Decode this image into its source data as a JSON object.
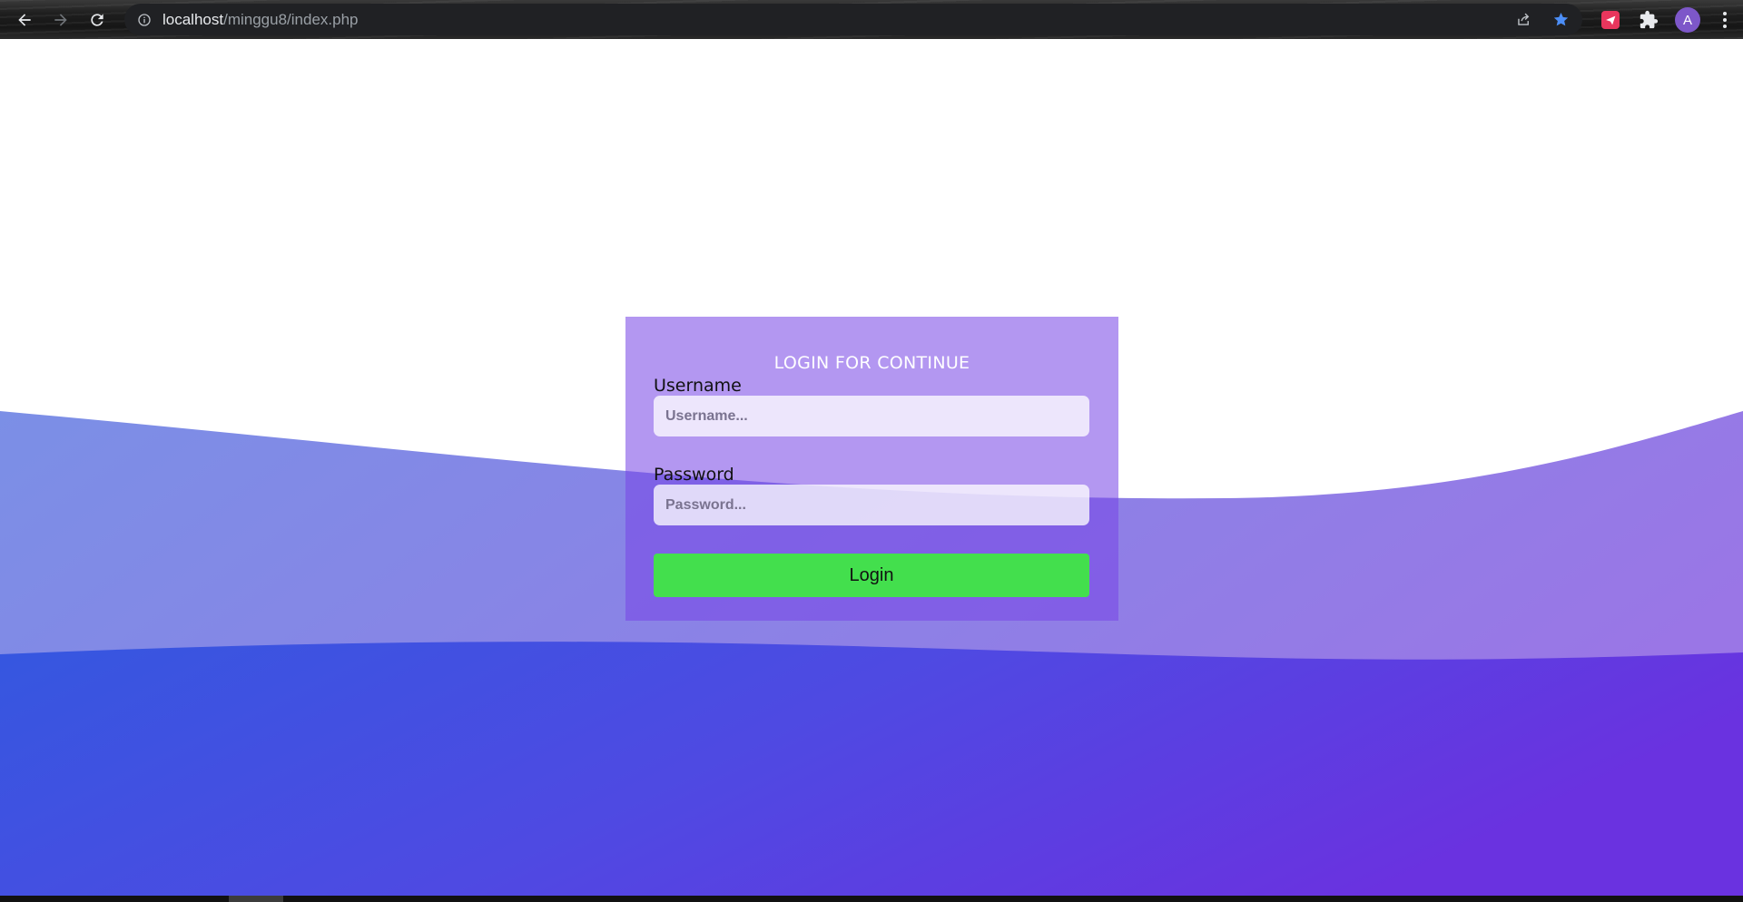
{
  "browser": {
    "url_host": "localhost",
    "url_path": "/minggu8/index.php",
    "avatar_letter": "A",
    "icons": {
      "back": "arrow-left-icon",
      "forward": "arrow-right-icon",
      "reload": "reload-icon",
      "site_info": "info-icon",
      "share": "share-icon",
      "bookmark": "star-icon",
      "extension": "send-icon",
      "extensions_menu": "puzzle-icon",
      "menu": "kebab-menu-icon"
    },
    "colors": {
      "bookmark_star": "#4c8ef7",
      "extension_bg": "#e8365d",
      "avatar_bg": "#7d57c9"
    }
  },
  "login": {
    "title": "LOGIN FOR CONTINUE",
    "username_label": "Username",
    "username_placeholder": "Username...",
    "username_value": "",
    "password_label": "Password",
    "password_placeholder": "Password...",
    "password_value": "",
    "button_label": "Login"
  },
  "colors": {
    "wave_left": "#2f5be0",
    "wave_right": "#6a32e0",
    "panel": "rgba(120, 70, 230, 0.56)",
    "button": "#43df4d"
  }
}
